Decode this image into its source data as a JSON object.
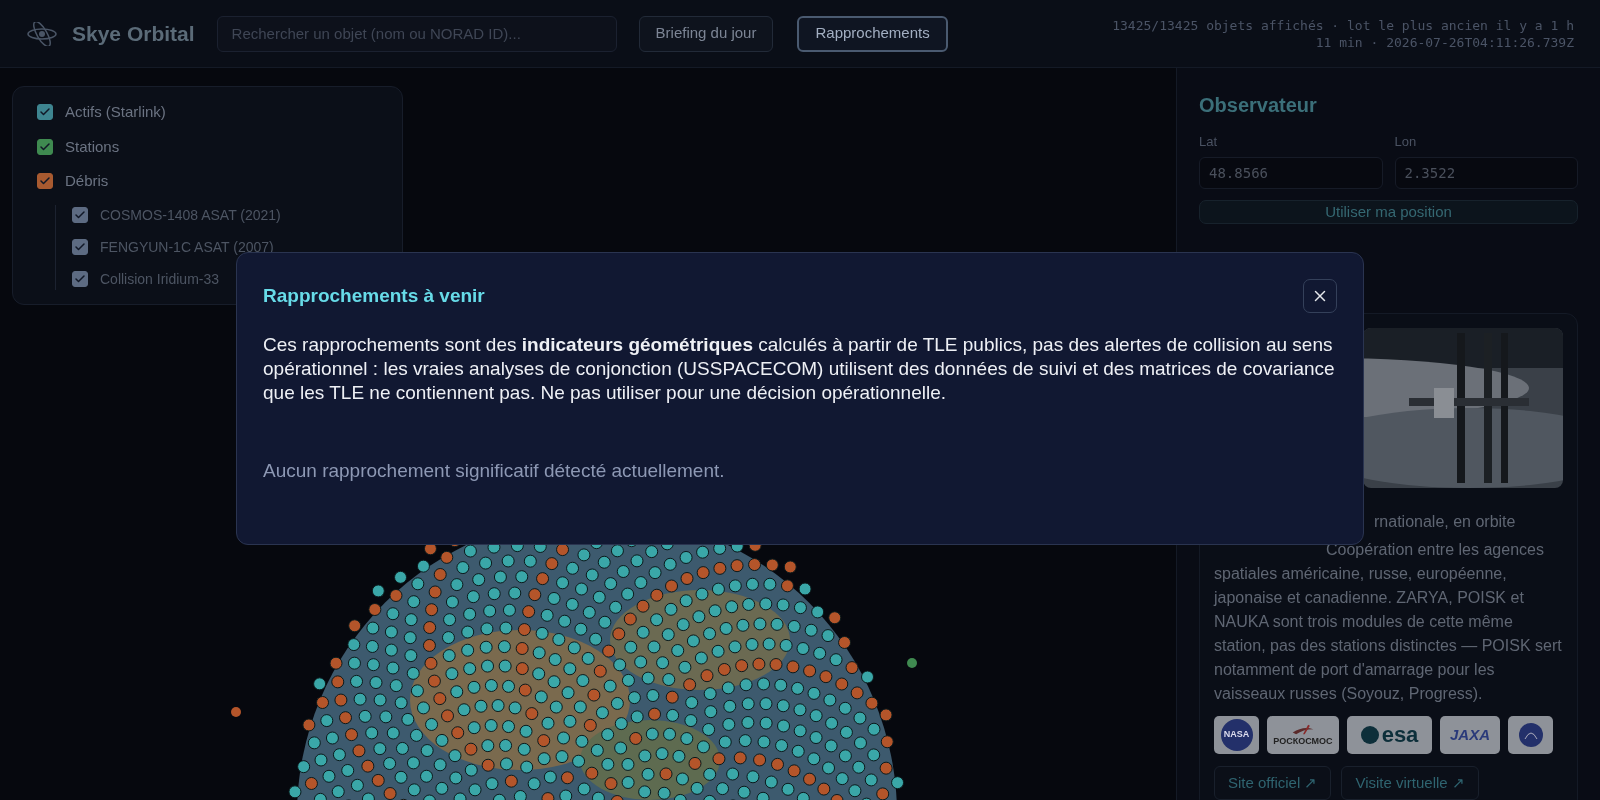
{
  "app": {
    "title": "Skye Orbital"
  },
  "search": {
    "placeholder": "Rechercher un objet (nom ou NORAD ID)..."
  },
  "nav_buttons": [
    {
      "label": "Briefing du jour",
      "selected": false
    },
    {
      "label": "Rapprochements",
      "selected": true
    }
  ],
  "status": [
    "13425/13425 objets affichés · lot le plus ancien il y a 1 h",
    "11 min · 2026-07-26T04:11:26.739Z"
  ],
  "layers": [
    {
      "label": "Actifs (Starlink)",
      "checked": true,
      "color": "#3e8590"
    },
    {
      "label": "Stations",
      "checked": true,
      "color": "#3f8a50"
    },
    {
      "label": "Débris",
      "checked": true,
      "color": "#a85a30",
      "children": [
        {
          "label": "COSMOS-1408 ASAT (2021)",
          "checked": true
        },
        {
          "label": "FENGYUN-1C ASAT (2007)",
          "checked": true
        },
        {
          "label": "Collision Iridium-33",
          "checked": true
        }
      ]
    }
  ],
  "observer": {
    "title": "Observateur",
    "lat": {
      "label": "Lat",
      "value": "48.8566"
    },
    "lon": {
      "label": "Lon",
      "value": "2.3522"
    },
    "button": "Utiliser ma position"
  },
  "station_card": {
    "fragment": "rnationale, en orbite",
    "description": "Coopération entre les agences spatiales américaine, russe, européenne, japonaise et canadienne. ZARYA, POISK et NAUKA sont trois modules de cette même station, pas des stations distinctes — POISK sert notamment de port d'amarrage pour les vaisseaux russes (Soyouz, Progress).",
    "logos": [
      {
        "kind": "nasa",
        "text": "NASA"
      },
      {
        "kind": "roscosmos",
        "text": "РОСКОСМОС"
      },
      {
        "kind": "esa",
        "text": "esa"
      },
      {
        "kind": "jaxa",
        "text": "JAXA"
      },
      {
        "kind": "csa"
      }
    ],
    "links": [
      "Site officiel ↗",
      "Visite virtuelle ↗"
    ]
  },
  "modal": {
    "title": "Rapprochements à venir",
    "body": "Ces rapprochements sont des **indicateurs géométriques** calculés à partir de TLE publics, pas des alertes de collision au sens opérationnel : les vraies analyses de conjonction (USSPACECOM) utilisent des données de suivi et des matrices de covariance que les TLE ne contiennent pas. Ne pas utiliser pour une décision opérationnelle.",
    "empty": "Aucun rapprochement significatif détecté actuellement."
  }
}
